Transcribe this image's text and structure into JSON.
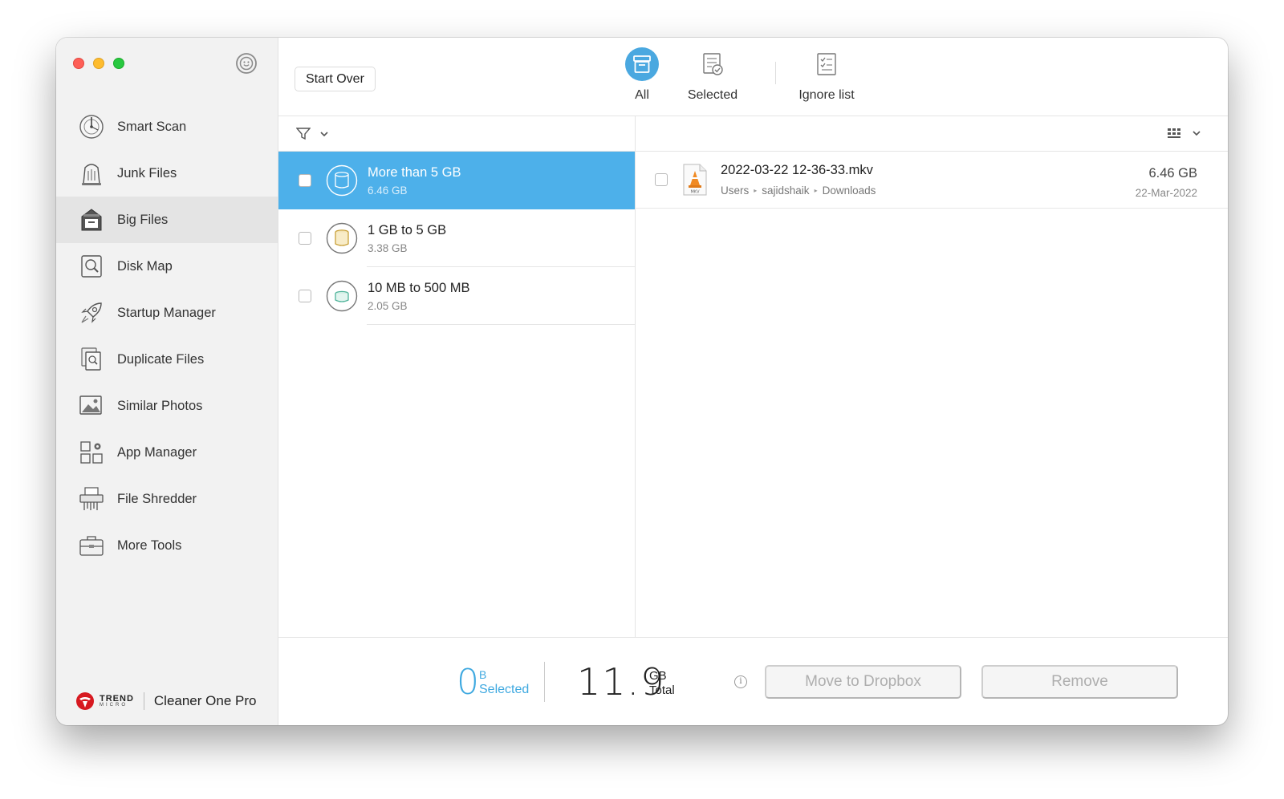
{
  "app": {
    "name": "Cleaner One Pro",
    "brand": "TREND",
    "brand_sub": "MICRO"
  },
  "sidebar": {
    "items": [
      {
        "label": "Smart Scan",
        "icon": "smart-scan-icon"
      },
      {
        "label": "Junk Files",
        "icon": "junk-files-icon"
      },
      {
        "label": "Big Files",
        "icon": "big-files-icon",
        "active": true
      },
      {
        "label": "Disk Map",
        "icon": "disk-map-icon"
      },
      {
        "label": "Startup Manager",
        "icon": "rocket-icon"
      },
      {
        "label": "Duplicate Files",
        "icon": "duplicate-files-icon"
      },
      {
        "label": "Similar Photos",
        "icon": "photos-icon"
      },
      {
        "label": "App Manager",
        "icon": "app-manager-icon"
      },
      {
        "label": "File Shredder",
        "icon": "shredder-icon"
      },
      {
        "label": "More Tools",
        "icon": "toolbox-icon"
      }
    ]
  },
  "toolbar": {
    "start_over": "Start Over",
    "tabs": [
      {
        "label": "All",
        "active": true
      },
      {
        "label": "Selected"
      },
      {
        "label": "Ignore list"
      }
    ]
  },
  "categories": [
    {
      "title": "More than 5 GB",
      "size": "6.46 GB",
      "selected": true,
      "color": "#ffffff"
    },
    {
      "title": "1 GB to 5 GB",
      "size": "3.38 GB",
      "color": "#d6a93a"
    },
    {
      "title": "10 MB to 500 MB",
      "size": "2.05 GB",
      "color": "#55b8a0"
    }
  ],
  "files": [
    {
      "name": "2022-03-22 12-36-33.mkv",
      "path": [
        "Users",
        "sajidshaik",
        "Downloads"
      ],
      "size": "6.46 GB",
      "date": "22-Mar-2022",
      "type_label": "MKV"
    }
  ],
  "footer": {
    "selected_value": "0",
    "selected_unit": "B",
    "selected_label": "Selected",
    "total_value": "11.9",
    "total_unit": "GB",
    "total_label": "Total",
    "info": "i",
    "move_button": "Move to Dropbox",
    "remove_button": "Remove"
  },
  "colors": {
    "accent": "#4db0ea",
    "selected_text": "#3fa9e0"
  }
}
